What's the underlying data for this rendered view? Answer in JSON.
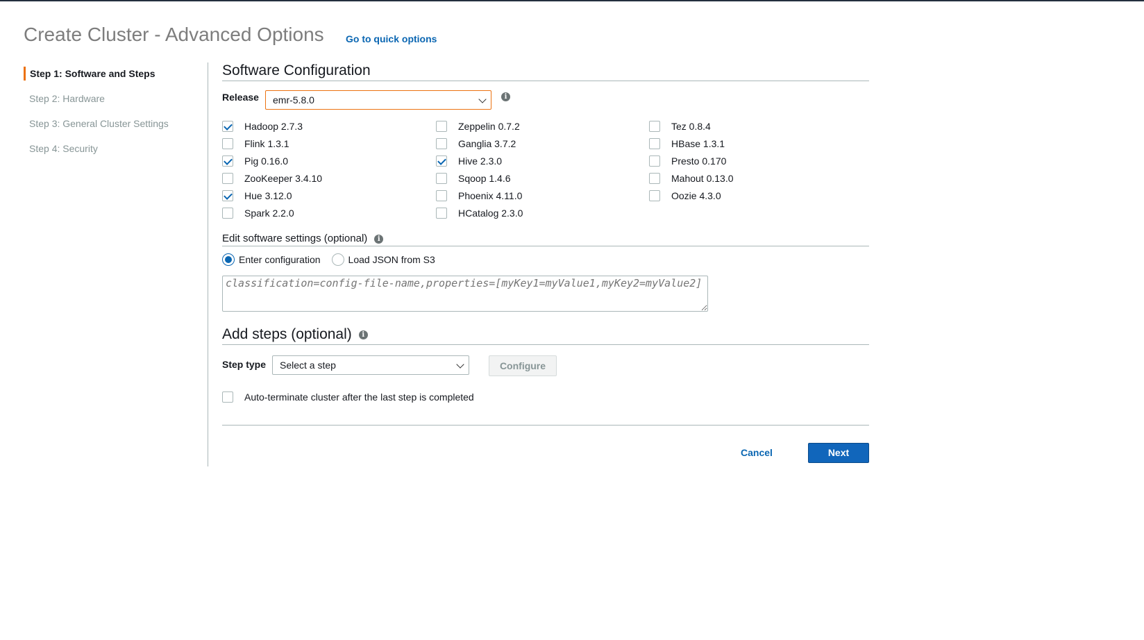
{
  "header": {
    "title": "Create Cluster - Advanced Options",
    "quick_options_link": "Go to quick options"
  },
  "sidebar": {
    "steps": [
      {
        "label": "Step 1: Software and Steps",
        "active": true
      },
      {
        "label": "Step 2: Hardware",
        "active": false
      },
      {
        "label": "Step 3: General Cluster Settings",
        "active": false
      },
      {
        "label": "Step 4: Security",
        "active": false
      }
    ]
  },
  "software": {
    "title": "Software Configuration",
    "release_label": "Release",
    "release_value": "emr-5.8.0",
    "applications": [
      {
        "label": "Hadoop 2.7.3",
        "checked": true
      },
      {
        "label": "Zeppelin 0.7.2",
        "checked": false
      },
      {
        "label": "Tez 0.8.4",
        "checked": false
      },
      {
        "label": "Flink 1.3.1",
        "checked": false
      },
      {
        "label": "Ganglia 3.7.2",
        "checked": false
      },
      {
        "label": "HBase 1.3.1",
        "checked": false
      },
      {
        "label": "Pig 0.16.0",
        "checked": true
      },
      {
        "label": "Hive 2.3.0",
        "checked": true
      },
      {
        "label": "Presto 0.170",
        "checked": false
      },
      {
        "label": "ZooKeeper 3.4.10",
        "checked": false
      },
      {
        "label": "Sqoop 1.4.6",
        "checked": false
      },
      {
        "label": "Mahout 0.13.0",
        "checked": false
      },
      {
        "label": "Hue 3.12.0",
        "checked": true
      },
      {
        "label": "Phoenix 4.11.0",
        "checked": false
      },
      {
        "label": "Oozie 4.3.0",
        "checked": false
      },
      {
        "label": "Spark 2.2.0",
        "checked": false
      },
      {
        "label": "HCatalog 2.3.0",
        "checked": false
      }
    ]
  },
  "edit_settings": {
    "title": "Edit software settings (optional)",
    "option_enter": "Enter configuration",
    "option_load": "Load JSON from S3",
    "selected_option": "Enter configuration",
    "config_placeholder": "classification=config-file-name,properties=[myKey1=myValue1,myKey2=myValue2]"
  },
  "add_steps": {
    "title": "Add steps (optional)",
    "step_type_label": "Step type",
    "step_type_value": "Select a step",
    "configure_label": "Configure",
    "auto_terminate_label": "Auto-terminate cluster after the last step is completed",
    "auto_terminate_checked": false
  },
  "footer": {
    "cancel_label": "Cancel",
    "next_label": "Next"
  },
  "colors": {
    "accent_orange": "#ec7211",
    "link_blue": "#0a66b2",
    "primary_button": "#1166bb"
  }
}
